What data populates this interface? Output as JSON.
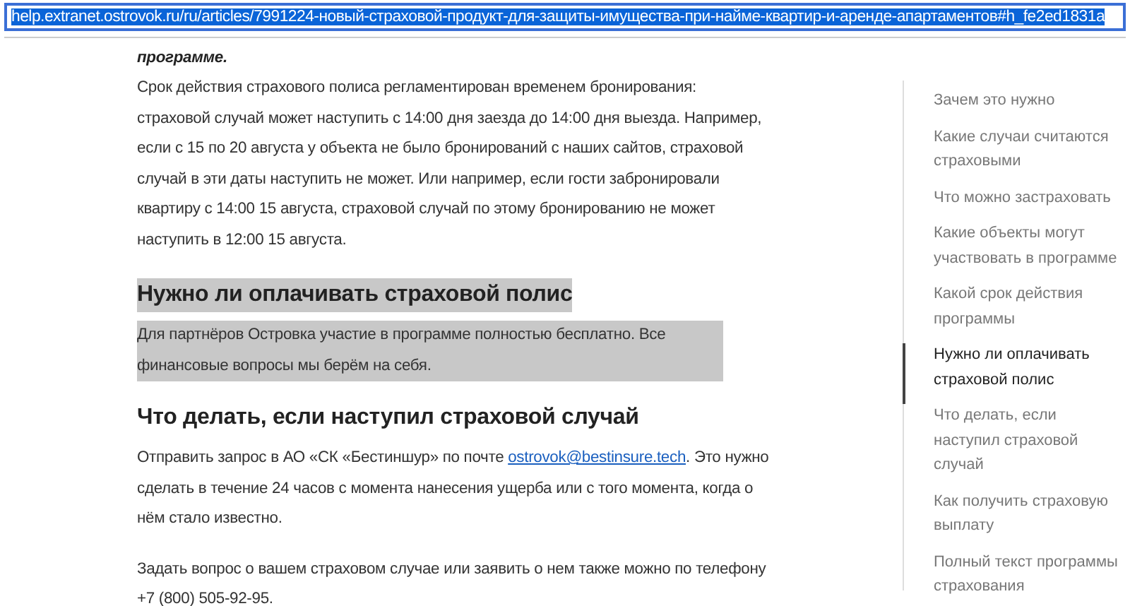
{
  "address_bar": {
    "url": "help.extranet.ostrovok.ru/ru/articles/7991224-новый-страховой-продукт-для-защиты-имущества-при-найме-квартир-и-аренде-апартаментов#h_fe2ed1831a",
    "selected": true
  },
  "article": [
    {
      "kind": "lead",
      "text": "программе.",
      "highlighted": false
    },
    {
      "kind": "paragraph",
      "text": "Срок действия страхового полиса регламентирован временем бронирования: страховой случай может наступить с 14:00 дня заезда до 14:00 дня выезда. Например, если с 15 по 20 августа у объекта не было бронирований с наших сайтов, страховой случай в эти даты наступить не может. Или например, если гости забронировали квартиру с 14:00 15 августа, страховой случай по этому бронированию не может наступить в 12:00 15 августа.",
      "highlighted": false
    },
    {
      "kind": "heading",
      "text": "Нужно ли оплачивать страховой полис",
      "highlighted": true
    },
    {
      "kind": "paragraph",
      "text": "Для партнёров Островка участие в программе полностью бесплатно. Все финансовые вопросы мы берём на себя.",
      "highlighted": true
    },
    {
      "kind": "heading",
      "text": "Что делать, если наступил страховой случай",
      "highlighted": false
    },
    {
      "kind": "link_paragraph",
      "before": "Отправить запрос в АО «СК «Бестиншур» по почте ",
      "link": "ostrovok@bestinsure.tech",
      "after": ". Это нужно сделать в течение 24 часов с момента нанесения ущерба или с того момента, когда о нём стало известно.",
      "highlighted": false
    },
    {
      "kind": "paragraph",
      "text": "Задать вопрос о вашем страховом случае или заявить о нем также можно по телефону +7 (800) 505-92-95.",
      "highlighted": false
    }
  ],
  "table_of_contents": [
    {
      "label": "Зачем это нужно",
      "selected": false
    },
    {
      "label": "Какие случаи считаются страховыми",
      "selected": false
    },
    {
      "label": "Что можно застраховать",
      "selected": false
    },
    {
      "label": "Какие объекты могут участвовать в программе",
      "selected": false
    },
    {
      "label": "Какой срок действия программы",
      "selected": false
    },
    {
      "label": "Нужно ли оплачивать страховой полис",
      "selected": true
    },
    {
      "label": "Что делать, если наступил страховой случай",
      "selected": false
    },
    {
      "label": "Как получить страховую выплату",
      "selected": false
    },
    {
      "label": "Полный текст программы страхования",
      "selected": false
    }
  ]
}
